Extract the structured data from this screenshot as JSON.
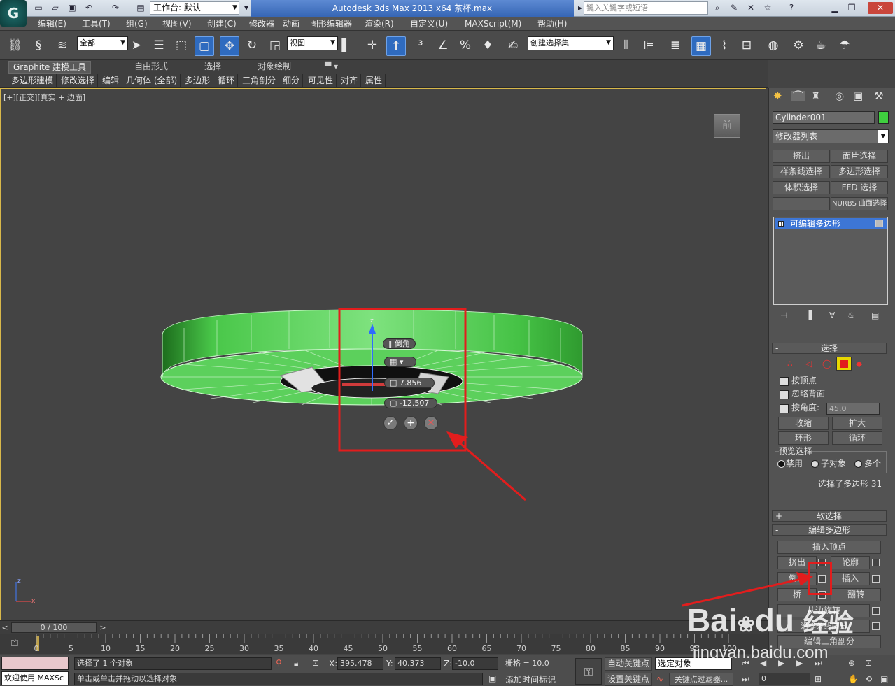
{
  "title_bar": {
    "app_logo": "G",
    "workspace": "工作台: 默认",
    "title": "Autodesk 3ds Max  2013 x64        茶杯.max",
    "search_placeholder": "键入关键字或短语"
  },
  "menu": [
    "编辑(E)",
    "工具(T)",
    "组(G)",
    "视图(V)",
    "创建(C)",
    "修改器",
    "动画",
    "图形编辑器",
    "渲染(R)",
    "自定义(U)",
    "MAXScript(M)",
    "帮助(H)"
  ],
  "toolbar": {
    "filter": "全部",
    "ref_coord": "视图",
    "selection_set": "创建选择集"
  },
  "ribbon": {
    "tabs": [
      "Graphite 建模工具",
      "自由形式",
      "选择",
      "对象绘制"
    ],
    "sub": [
      "多边形建模",
      "修改选择",
      "编辑",
      "几何体 (全部)",
      "多边形",
      "循环",
      "三角剖分",
      "细分",
      "可见性",
      "对齐",
      "属性"
    ]
  },
  "viewport": {
    "label": "[+][正交][真实 + 边面]",
    "viewcube": "前",
    "caddy": {
      "title": "倒角",
      "value1": "7.856",
      "value2": "-12.507"
    }
  },
  "command_panel": {
    "object_name": "Cylinder001",
    "object_color": "#3fcf3f",
    "modifier_list": "修改器列表",
    "mod_buttons": [
      "挤出",
      "面片选择",
      "样条线选择",
      "多边形选择",
      "体积选择",
      "FFD 选择",
      "",
      "NURBS 曲面选择"
    ],
    "stack_item": "可编辑多边形",
    "selection": {
      "header": "选择",
      "by_vertex": "按顶点",
      "ignore_backfacing": "忽略背面",
      "by_angle": "按角度:",
      "angle_value": "45.0",
      "shrink": "收缩",
      "grow": "扩大",
      "ring": "环形",
      "loop": "循环",
      "preview_group": "预览选择",
      "preview_opts": [
        "禁用",
        "子对象",
        "多个"
      ],
      "status": "选择了多边形 31"
    },
    "soft_selection": "软选择",
    "edit_poly": {
      "header": "编辑多边形",
      "insert_vertex": "插入顶点",
      "extrude": "挤出",
      "outline": "轮廓",
      "bevel": "倒角",
      "inset": "插入",
      "bridge": "桥",
      "flip": "翻转",
      "hinge": "从边旋转",
      "extrude_spline": "沿样条线挤出",
      "edit_tri": "编辑三角剖分"
    }
  },
  "timeline": {
    "frame": "0 / 100",
    "ticks": [
      "0",
      "5",
      "10",
      "15",
      "20",
      "25",
      "30",
      "35",
      "40",
      "45",
      "50",
      "55",
      "60",
      "65",
      "70",
      "75",
      "80",
      "85",
      "90",
      "95",
      "100"
    ]
  },
  "status": {
    "welcome": "欢迎使用 MAXSc",
    "selected": "选择了 1 个对象",
    "prompt": "单击或单击并拖动以选择对象",
    "x_label": "X:",
    "x": "395.478",
    "y_label": "Y:",
    "y": "40.373",
    "z_label": "Z:",
    "z": "-10.0",
    "grid": "栅格 = 10.0",
    "auto_key": "自动关键点",
    "set_key": "设置关键点",
    "key_mode": "选定对象",
    "key_filters": "关键点过滤器...",
    "add_time_tag": "添加时间标记",
    "frame_field": "0"
  },
  "watermark": {
    "brand": "Bai",
    "brand2": "du",
    "cn": "经验",
    "url": "jingyan.baidu.com"
  }
}
